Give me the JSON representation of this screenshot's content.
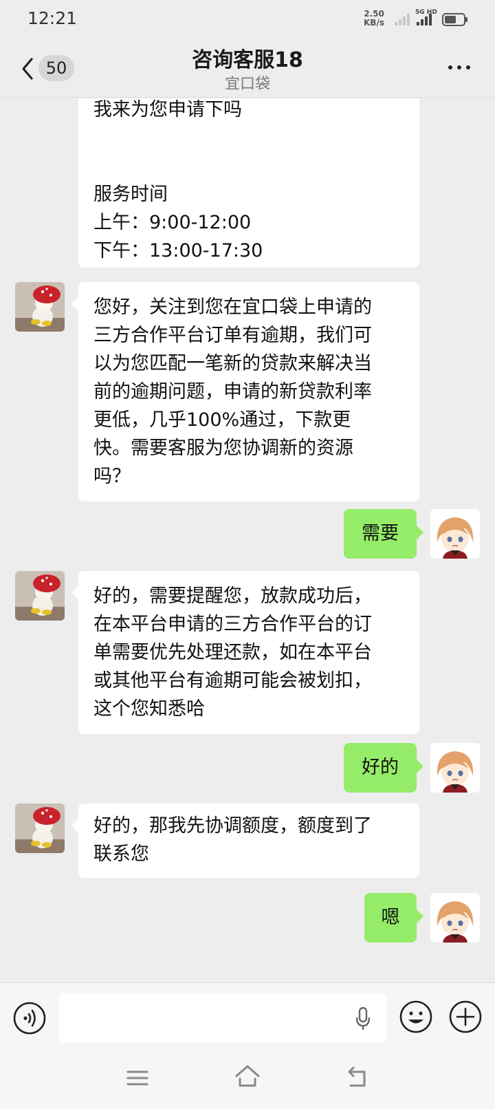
{
  "status_bar": {
    "time": "12:21",
    "net_speed_value": "2.50",
    "net_speed_unit": "KB/s",
    "signal_label": "5G HD"
  },
  "header": {
    "unread_count": "50",
    "title": "咨询客服18",
    "subtitle": "宜口袋"
  },
  "messages": [
    {
      "from": "agent",
      "text": "我来为您申请下吗\n\n\n服务时间\n上午：9:00-12:00\n下午：13:00-17:30"
    },
    {
      "from": "agent",
      "text": "您好，关注到您在宜口袋上申请的\n三方合作平台订单有逾期，我们可\n以为您匹配一笔新的贷款来解决当\n前的逾期问题，申请的新贷款利率\n更低，几乎100%通过，下款更\n快。需要客服为您协调新的资源\n吗？"
    },
    {
      "from": "me",
      "text": "需要"
    },
    {
      "from": "agent",
      "text": "好的，需要提醒您，放款成功后，\n在本平台申请的三方合作平台的订\n单需要优先处理还款，如在本平台\n或其他平台有逾期可能会被划扣，\n这个您知悉哈"
    },
    {
      "from": "me",
      "text": "好的"
    },
    {
      "from": "agent",
      "text": "好的，那我先协调额度，额度到了\n联系您"
    },
    {
      "from": "me",
      "text": "嗯"
    }
  ],
  "input": {
    "value": ""
  },
  "icons": {
    "back": "chevron-left-icon",
    "more": "more-horizontal-icon",
    "voice": "voice-icon",
    "mic": "microphone-icon",
    "emoji": "emoji-icon",
    "plus": "plus-circle-icon",
    "nav_menu": "menu-icon",
    "nav_home": "home-icon",
    "nav_back": "back-arrow-icon"
  },
  "colors": {
    "background": "#ededed",
    "incoming_bubble": "#ffffff",
    "outgoing_bubble": "#95ec69"
  }
}
